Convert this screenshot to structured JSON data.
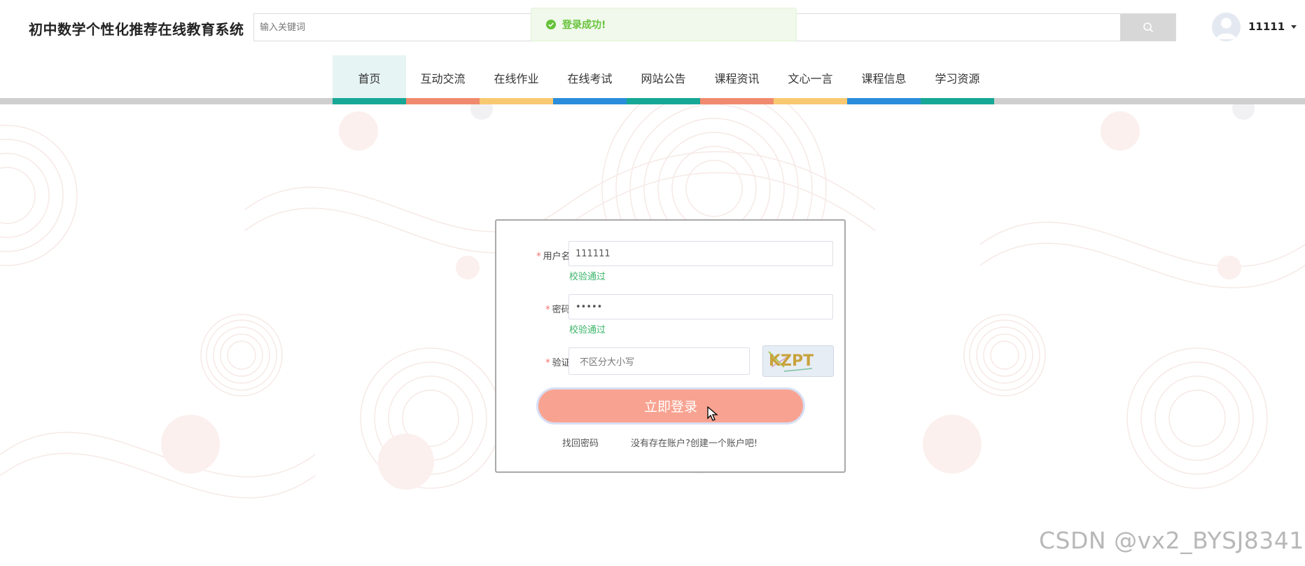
{
  "header": {
    "site_title": "初中数学个性化推荐在线教育系统",
    "search_placeholder": "输入关键词",
    "toast_text": "登录成功!",
    "user_name": "11111"
  },
  "nav": {
    "items": [
      {
        "label": "首页",
        "color": "#16a796"
      },
      {
        "label": "互动交流",
        "color": "#f08a6e"
      },
      {
        "label": "在线作业",
        "color": "#f8c971"
      },
      {
        "label": "在线考试",
        "color": "#2a8ddb"
      },
      {
        "label": "网站公告",
        "color": "#16a796"
      },
      {
        "label": "课程资讯",
        "color": "#f08a6e"
      },
      {
        "label": "文心一言",
        "color": "#f8c971"
      },
      {
        "label": "课程信息",
        "color": "#2a8ddb"
      },
      {
        "label": "学习资源",
        "color": "#16a796"
      }
    ]
  },
  "login": {
    "username_label": "用户名:",
    "username_value": "111111",
    "username_valid": "校验通过",
    "password_label": "密码:",
    "password_value": "•••••",
    "password_valid": "校验通过",
    "captcha_label": "验证:",
    "captcha_placeholder": "不区分大小写",
    "captcha_text": "KZPT",
    "submit_label": "立即登录",
    "forgot_link": "找回密码",
    "register_link": "没有存在账户?创建一个账户吧!"
  },
  "watermark": "CSDN @vx2_BYSJ8341"
}
